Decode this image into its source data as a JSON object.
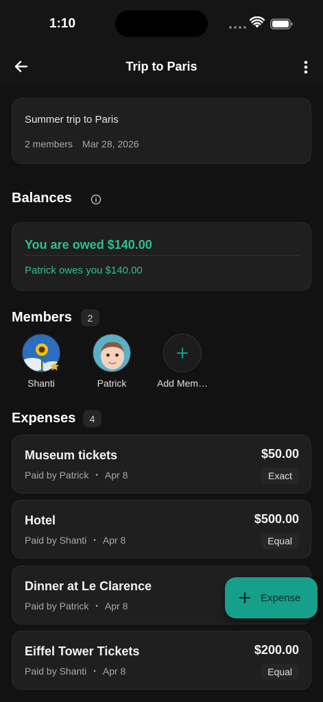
{
  "status_bar": {
    "time": "1:10"
  },
  "app_bar": {
    "title": "Trip to Paris"
  },
  "trip": {
    "description": "Summer trip to Paris",
    "members_count_text": "2 members",
    "date": "Mar 28, 2026"
  },
  "balances": {
    "title": "Balances",
    "summary": "You are owed $140.00",
    "details": [
      "Patrick owes you $140.00"
    ],
    "accent_color": "#2fbf8a"
  },
  "members": {
    "title": "Members",
    "count": "2",
    "items": [
      {
        "name": "Shanti"
      },
      {
        "name": "Patrick"
      }
    ],
    "add_label": "Add Mem…"
  },
  "expenses": {
    "title": "Expenses",
    "count": "4",
    "items": [
      {
        "title": "Museum tickets",
        "paid_by": "Paid by Patrick",
        "date": "Apr 8",
        "amount": "$50.00",
        "split": "Exact"
      },
      {
        "title": "Hotel",
        "paid_by": "Paid by Shanti",
        "date": "Apr 8",
        "amount": "$500.00",
        "split": "Equal"
      },
      {
        "title": "Dinner at Le Clarence",
        "paid_by": "Paid by Patrick",
        "date": "Apr 8",
        "amount": "",
        "split": ""
      },
      {
        "title": "Eiffel Tower Tickets",
        "paid_by": "Paid by Shanti",
        "date": "Apr 8",
        "amount": "$200.00",
        "split": "Equal"
      }
    ]
  },
  "fab": {
    "label": "Expense",
    "color": "#16a08c"
  },
  "meta_separator": "•"
}
